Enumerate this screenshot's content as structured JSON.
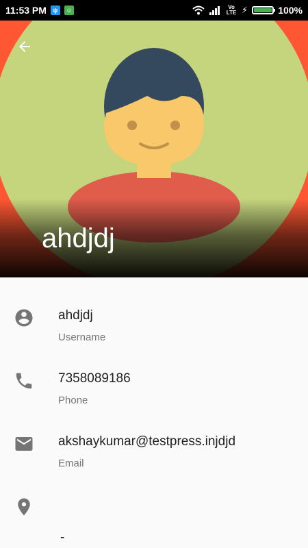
{
  "status_bar": {
    "time": "11:53 PM",
    "battery_percent": "100%",
    "network_label": "Vo LTE",
    "battery_level": 1.0
  },
  "header": {
    "back_icon": "arrow-back-icon",
    "name": "ahdjdj",
    "colors": {
      "background": "#ff5733",
      "circle": "#c5d57e",
      "hair": "#34495e",
      "face": "#f9c86a",
      "body": "#e05c4b"
    }
  },
  "details": [
    {
      "icon": "account-circle-icon",
      "value": "ahdjdj",
      "label": "Username"
    },
    {
      "icon": "phone-icon",
      "value": "7358089186",
      "label": "Phone"
    },
    {
      "icon": "email-icon",
      "value": "akshaykumar@testpress.injdjd",
      "label": "Email"
    },
    {
      "icon": "location-icon",
      "value": "-",
      "label": ""
    }
  ]
}
